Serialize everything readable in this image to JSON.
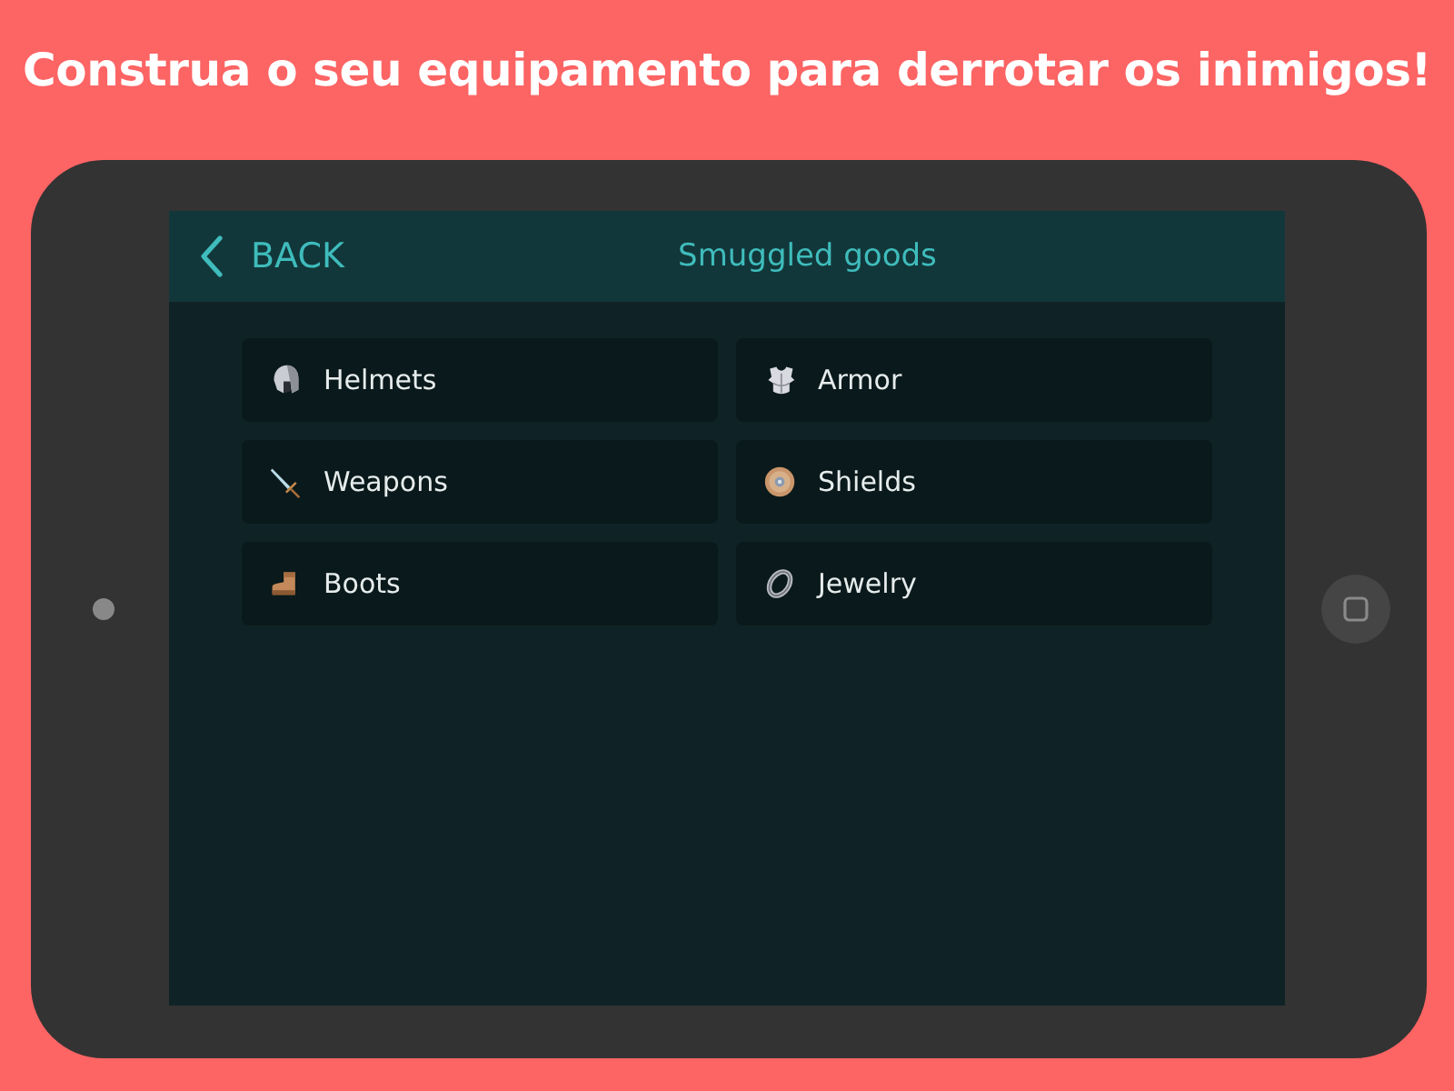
{
  "headline": "Construa o seu equipamento para derrotar os inimigos!",
  "header": {
    "back_label": "BACK",
    "title": "Smuggled goods"
  },
  "categories": [
    {
      "label": "Helmets"
    },
    {
      "label": "Armor"
    },
    {
      "label": "Weapons"
    },
    {
      "label": "Shields"
    },
    {
      "label": "Boots"
    },
    {
      "label": "Jewelry"
    }
  ]
}
